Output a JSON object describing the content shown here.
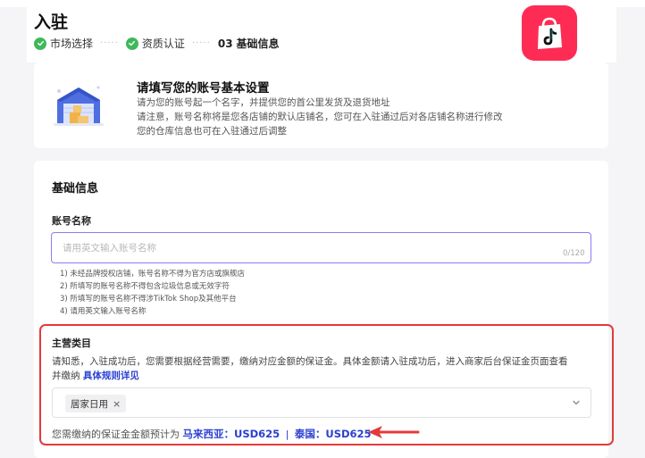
{
  "header": {
    "title": "入驻",
    "steps": [
      {
        "label": "市场选择",
        "state": "done"
      },
      {
        "label": "资质认证",
        "state": "done"
      },
      {
        "number": "03",
        "label": "基础信息",
        "state": "current"
      }
    ],
    "logo_icon": "tiktok-shop-logo-icon",
    "logo_color": "#fe2c55"
  },
  "intro": {
    "title": "请填写您的账号基本设置",
    "lines": [
      "请为您的账号起一个名字，并提供您的首公里发货及退货地址",
      "请注意，账号名称将是您各店铺的默认店铺名，您可在入驻通过后对各店铺名称进行修改",
      "您的仓库信息也可在入驻通过后调整"
    ],
    "icon": "warehouse-icon"
  },
  "form": {
    "section_title": "基础信息",
    "account_name": {
      "label": "账号名称",
      "placeholder": "请用英文输入账号名称",
      "value": "",
      "counter": "0/120",
      "focus_color": "#8c7bf2"
    },
    "rules": [
      "1) 未经品牌授权店铺，账号名称不得为官方店或旗舰店",
      "2) 所填写的账号名称不得包含垃圾信息或无效字符",
      "3) 所填写的账号名称不得涉TikTok Shop及其他平台",
      "4) 请用英文输入账号名称"
    ]
  },
  "category": {
    "label": "主营类目",
    "notice_line1": "请知悉，入驻成功后，您需要根据经营需要，缴纳对应金额的保证金。具体金额请入驻成功后，进入商家后台保证金页面查看",
    "notice_line2": "并缴纳",
    "link": "具体规则详见",
    "selected_tag": "居家日用",
    "tag_remove": "×",
    "deposit_prefix": "您需缴纳的保证金金额预计为",
    "deposit_my": "马来西亚：USD625",
    "deposit_sep": "|",
    "deposit_th": "泰国：USD625",
    "highlight_color": "#e33a3a",
    "link_color": "#2a3fd1"
  }
}
